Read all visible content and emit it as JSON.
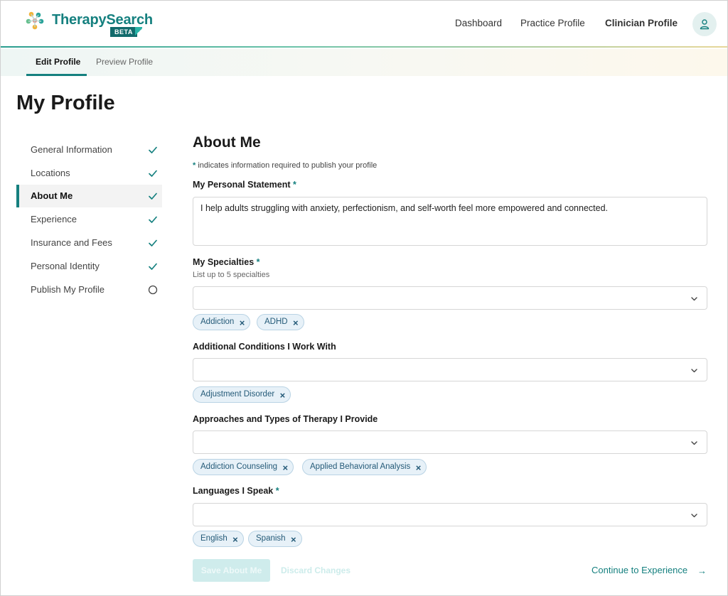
{
  "brand": {
    "name": "TherapySearch",
    "badge": "BETA"
  },
  "nav": {
    "dashboard": "Dashboard",
    "practice_profile": "Practice Profile",
    "clinician_profile": "Clinician Profile"
  },
  "tabs": {
    "edit": "Edit Profile",
    "preview": "Preview Profile"
  },
  "page_title": "My Profile",
  "sidebar": {
    "items": [
      {
        "label": "General Information",
        "status": "complete"
      },
      {
        "label": "Locations",
        "status": "complete"
      },
      {
        "label": "About Me",
        "status": "complete"
      },
      {
        "label": "Experience",
        "status": "complete"
      },
      {
        "label": "Insurance and Fees",
        "status": "complete"
      },
      {
        "label": "Personal Identity",
        "status": "complete"
      },
      {
        "label": "Publish My Profile",
        "status": "incomplete"
      }
    ]
  },
  "main": {
    "title": "About Me",
    "required_star": "*",
    "required_note": "indicates information required to publish your profile",
    "statement": {
      "label": "My Personal Statement",
      "value": "I help adults struggling with anxiety, perfectionism, and self-worth feel more empowered and connected."
    },
    "specialties": {
      "label": "My Specialties",
      "help": "List up to 5 specialties",
      "chips": [
        "Addiction",
        "ADHD"
      ]
    },
    "conditions": {
      "label": "Additional Conditions I Work With",
      "chips": [
        "Adjustment Disorder"
      ]
    },
    "approaches": {
      "label": "Approaches and Types of Therapy I Provide",
      "chips": [
        "Addiction Counseling",
        "Applied Behavioral Analysis"
      ]
    },
    "languages": {
      "label": "Languages I Speak",
      "chips": [
        "English",
        "Spanish"
      ]
    }
  },
  "actions": {
    "save": "Save About Me",
    "discard": "Discard Changes",
    "continue": "Continue to Experience",
    "continue_arrow": "→"
  },
  "colors": {
    "accent": "#15807f",
    "chip_bg": "#e7f1f8",
    "chip_text": "#245a78"
  },
  "icons": {
    "check": "check-icon",
    "circle": "circle-icon",
    "chevron": "chevron-down-icon",
    "remove": "close-icon",
    "user": "user-icon"
  }
}
